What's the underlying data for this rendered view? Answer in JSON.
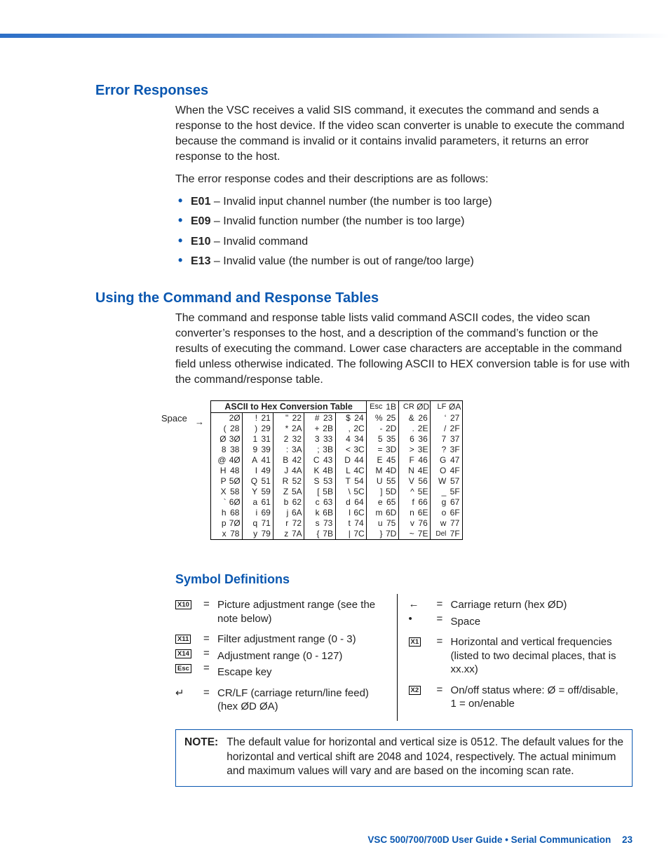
{
  "headings": {
    "h1": "Error Responses",
    "h2": "Using the Command and Response Tables",
    "h3": "Symbol Definitions"
  },
  "error_section": {
    "intro": "When the VSC receives a valid SIS command, it executes the command and sends a response to the host device.  If the video scan converter is unable to execute the command because the command is invalid or it contains invalid parameters, it returns an error response to the host.",
    "lead": "The error response codes and their descriptions are as follows:",
    "items": [
      {
        "code": "E01",
        "desc": " – Invalid input channel number (the number is too large)"
      },
      {
        "code": "E09",
        "desc": " – Invalid function number (the number is too large)"
      },
      {
        "code": "E10",
        "desc": " – Invalid command"
      },
      {
        "code": "E13",
        "desc": " – Invalid value (the number is out of range/too large)"
      }
    ]
  },
  "tables_intro": "The command and response table lists valid command ASCII codes, the video scan converter’s responses to the host, and a description of the command’s function or the results of executing the command. Lower case characters are acceptable in the command field unless otherwise indicated. The following ASCII to HEX conversion table is for use with the command/response table.",
  "conv_title": "ASCII to Hex  Conversion Table",
  "space_label": "Space",
  "chart_data": {
    "type": "table",
    "title": "ASCII to Hex Conversion Table",
    "header_extras": [
      [
        "Esc",
        "1B"
      ],
      [
        "CR",
        "ØD"
      ],
      [
        "LF",
        "ØA"
      ]
    ],
    "rows": [
      [
        [
          "",
          "2Ø"
        ],
        [
          "!",
          "21"
        ],
        [
          "\"",
          "22"
        ],
        [
          "#",
          "23"
        ],
        [
          "$",
          "24"
        ],
        [
          "%",
          "25"
        ],
        [
          "&",
          "26"
        ],
        [
          "‘",
          "27"
        ]
      ],
      [
        [
          "(",
          "28"
        ],
        [
          ")",
          "29"
        ],
        [
          "*",
          "2A"
        ],
        [
          "+",
          "2B"
        ],
        [
          ",",
          "2C"
        ],
        [
          "-",
          "2D"
        ],
        [
          ".",
          "2E"
        ],
        [
          "/",
          "2F"
        ]
      ],
      [
        [
          "Ø",
          "3Ø"
        ],
        [
          "1",
          "31"
        ],
        [
          "2",
          "32"
        ],
        [
          "3",
          "33"
        ],
        [
          "4",
          "34"
        ],
        [
          "5",
          "35"
        ],
        [
          "6",
          "36"
        ],
        [
          "7",
          "37"
        ]
      ],
      [
        [
          "8",
          "38"
        ],
        [
          "9",
          "39"
        ],
        [
          ":",
          "3A"
        ],
        [
          ";",
          "3B"
        ],
        [
          "<",
          "3C"
        ],
        [
          "=",
          "3D"
        ],
        [
          ">",
          "3E"
        ],
        [
          "?",
          "3F"
        ]
      ],
      [
        [
          "@",
          "4Ø"
        ],
        [
          "A",
          "41"
        ],
        [
          "B",
          "42"
        ],
        [
          "C",
          "43"
        ],
        [
          "D",
          "44"
        ],
        [
          "E",
          "45"
        ],
        [
          "F",
          "46"
        ],
        [
          "G",
          "47"
        ]
      ],
      [
        [
          "H",
          "48"
        ],
        [
          "I",
          "49"
        ],
        [
          "J",
          "4A"
        ],
        [
          "K",
          "4B"
        ],
        [
          "L",
          "4C"
        ],
        [
          "M",
          "4D"
        ],
        [
          "N",
          "4E"
        ],
        [
          "O",
          "4F"
        ]
      ],
      [
        [
          "P",
          "5Ø"
        ],
        [
          "Q",
          "51"
        ],
        [
          "R",
          "52"
        ],
        [
          "S",
          "53"
        ],
        [
          "T",
          "54"
        ],
        [
          "U",
          "55"
        ],
        [
          "V",
          "56"
        ],
        [
          "W",
          "57"
        ]
      ],
      [
        [
          "X",
          "58"
        ],
        [
          "Y",
          "59"
        ],
        [
          "Z",
          "5A"
        ],
        [
          "[",
          "5B"
        ],
        [
          "\\",
          "5C"
        ],
        [
          "]",
          "5D"
        ],
        [
          "^",
          "5E"
        ],
        [
          "_",
          "5F"
        ]
      ],
      [
        [
          "`",
          "6Ø"
        ],
        [
          "a",
          "61"
        ],
        [
          "b",
          "62"
        ],
        [
          "c",
          "63"
        ],
        [
          "d",
          "64"
        ],
        [
          "e",
          "65"
        ],
        [
          "f",
          "66"
        ],
        [
          "g",
          "67"
        ]
      ],
      [
        [
          "h",
          "68"
        ],
        [
          "i",
          "69"
        ],
        [
          "j",
          "6A"
        ],
        [
          "k",
          "6B"
        ],
        [
          "l",
          "6C"
        ],
        [
          "m",
          "6D"
        ],
        [
          "n",
          "6E"
        ],
        [
          "o",
          "6F"
        ]
      ],
      [
        [
          "p",
          "7Ø"
        ],
        [
          "q",
          "71"
        ],
        [
          "r",
          "72"
        ],
        [
          "s",
          "73"
        ],
        [
          "t",
          "74"
        ],
        [
          "u",
          "75"
        ],
        [
          "v",
          "76"
        ],
        [
          "w",
          "77"
        ]
      ],
      [
        [
          "x",
          "78"
        ],
        [
          "y",
          "79"
        ],
        [
          "z",
          "7A"
        ],
        [
          "{",
          "7B"
        ],
        [
          "|",
          "7C"
        ],
        [
          "}",
          "7D"
        ],
        [
          "~",
          "7E"
        ],
        [
          "Del",
          "7F"
        ]
      ]
    ]
  },
  "symbols": {
    "left": [
      {
        "badges": [
          "X10"
        ],
        "eq": "=",
        "desc": "Picture adjustment range (see the note below)"
      },
      {
        "badges": [
          "X11",
          "X14",
          "Esc"
        ],
        "eq_stack": [
          "=",
          "=",
          "="
        ],
        "desc_stack": [
          "Filter adjustment range (0 - 3)",
          "Adjustment range (0 - 127)",
          "Escape key"
        ]
      },
      {
        "glyph": "↵",
        "eq": "=",
        "desc": "CR/LF (carriage return/line feed) (hex ØD ØA)"
      }
    ],
    "right": [
      {
        "glyphs": [
          "←",
          "•"
        ],
        "eq_stack": [
          "=",
          "="
        ],
        "desc_stack": [
          "Carriage return (hex ØD)",
          "Space"
        ]
      },
      {
        "badges": [
          "X1"
        ],
        "eq": "=",
        "desc": "Horizontal and vertical frequencies (listed to two decimal places, that is xx.xx)"
      },
      {
        "badges": [
          "X2"
        ],
        "eq": "=",
        "desc": "On/off status where: Ø = off/disable, 1 = on/enable"
      }
    ]
  },
  "note_label": "NOTE:",
  "note_text": "The default value for horizontal and vertical size is 0512.  The default values for the horizontal and vertical shift are 2048 and 1024, respectively.  The actual minimum and maximum values will vary and are based on the incoming scan rate.",
  "footer": {
    "title": "VSC 500/700/700D User Guide • Serial Communication",
    "page": "23"
  }
}
